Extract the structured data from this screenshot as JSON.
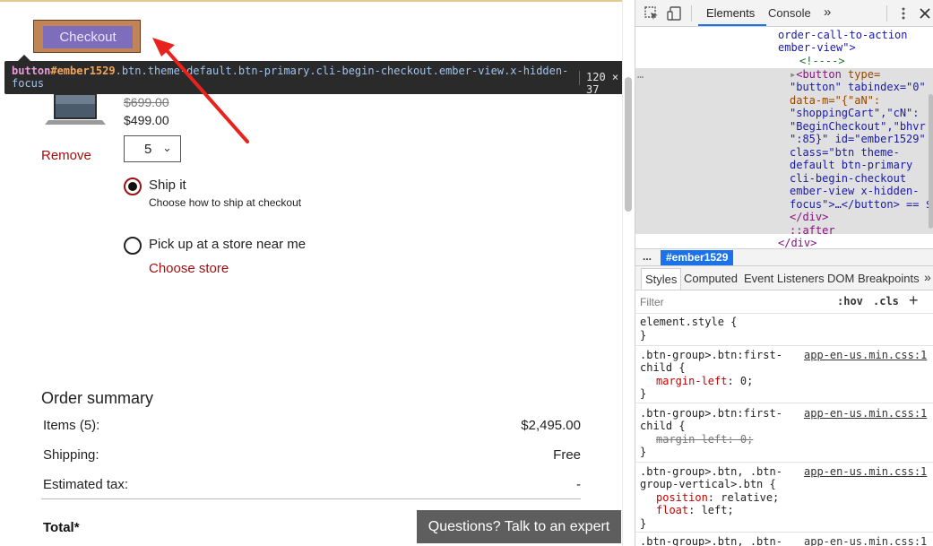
{
  "page": {
    "checkout_label": "Checkout",
    "tooltip": {
      "tag": "button",
      "id": "#ember1529",
      "classes": ".btn.theme-default.btn-primary.cli-begin-checkout.ember-view.x-hidden-focus",
      "size": "120 × 37"
    },
    "product": {
      "old_price": "$699.00",
      "new_price": "$499.00",
      "quantity": "5",
      "remove_label": "Remove"
    },
    "shipping": {
      "ship_label": "Ship it",
      "ship_sub": "Choose how to ship at checkout",
      "pickup_label": "Pick up at a store near me",
      "choose_store": "Choose store",
      "selected": "ship"
    },
    "summary": {
      "title": "Order summary",
      "rows": [
        {
          "label": "Items (5):",
          "value": "$2,495.00"
        },
        {
          "label": "Shipping:",
          "value": "Free"
        },
        {
          "label": "Estimated tax:",
          "value": "-"
        }
      ],
      "total_label": "Total*"
    },
    "expert_button": "Questions? Talk to an expert",
    "colors": {
      "remove_red": "#a11010",
      "highlight": "#c08457",
      "button_purple": "#7e6dbb",
      "arrow": "#e8221c"
    }
  },
  "devtools": {
    "tabs": [
      "Elements",
      "Console"
    ],
    "more_tabs": "»",
    "icons": [
      "inspect-icon",
      "device-toggle-icon",
      "kebab-menu-icon",
      "close-icon"
    ],
    "dom_lines": {
      "l1": "order-call-to-action",
      "l2": "ember-view\">",
      "l3": "<!---->",
      "l4a": "<button",
      "l4b": "type=",
      "l5": "\"button\" tabindex=\"0\"",
      "l6": "data-m=\"{\"aN\":",
      "l7": "\"shoppingCart\",\"cN\":",
      "l8": "\"BeginCheckout\",\"bhvr",
      "l9": "\":85}\" id=\"ember1529\"",
      "l10": "class=\"btn theme-",
      "l11": "default btn-primary",
      "l12": "cli-begin-checkout",
      "l13": "ember-view x-hidden-",
      "l14": "focus\">…</button> == $",
      "l15": "</div>",
      "l16": "::after",
      "l17": "</div>",
      "ellipsis": "…"
    },
    "breadcrumb": {
      "dots": "...",
      "current": "#ember1529"
    },
    "styles_tabs": [
      "Styles",
      "Computed",
      "Event Listeners",
      "DOM Breakpoints"
    ],
    "styles_more": "»",
    "filter": {
      "placeholder": "Filter",
      "hov": ":hov",
      "cls": ".cls",
      "plus": "+"
    },
    "rules": {
      "r0_sel": "element.style {",
      "r0_end": "}",
      "r1_sel1": ".btn-group>.btn:first-",
      "r1_sel2": "child {",
      "r1_prop": "margin-left",
      "r1_val": ": 0;",
      "r1_end": "}",
      "r1_src": "app-en-us.min.css:1",
      "r2_sel1": ".btn-group>.btn:first-",
      "r2_sel2": "child {",
      "r2_strike": "margin-left: 0;",
      "r2_end": "}",
      "r2_src": "app-en-us.min.css:1",
      "r3_sel1": ".btn-group>.btn, .btn-",
      "r3_sel2": "group-vertical>.btn {",
      "r3_p1": "position",
      "r3_v1": ": relative;",
      "r3_p2": "float",
      "r3_v2": ": left;",
      "r3_end": "}",
      "r3_src": "app-en-us.min.css:1",
      "r4_sel1": ".btn-group>.btn, .btn-",
      "r4_src": "app-en-us.min.css:1"
    }
  }
}
